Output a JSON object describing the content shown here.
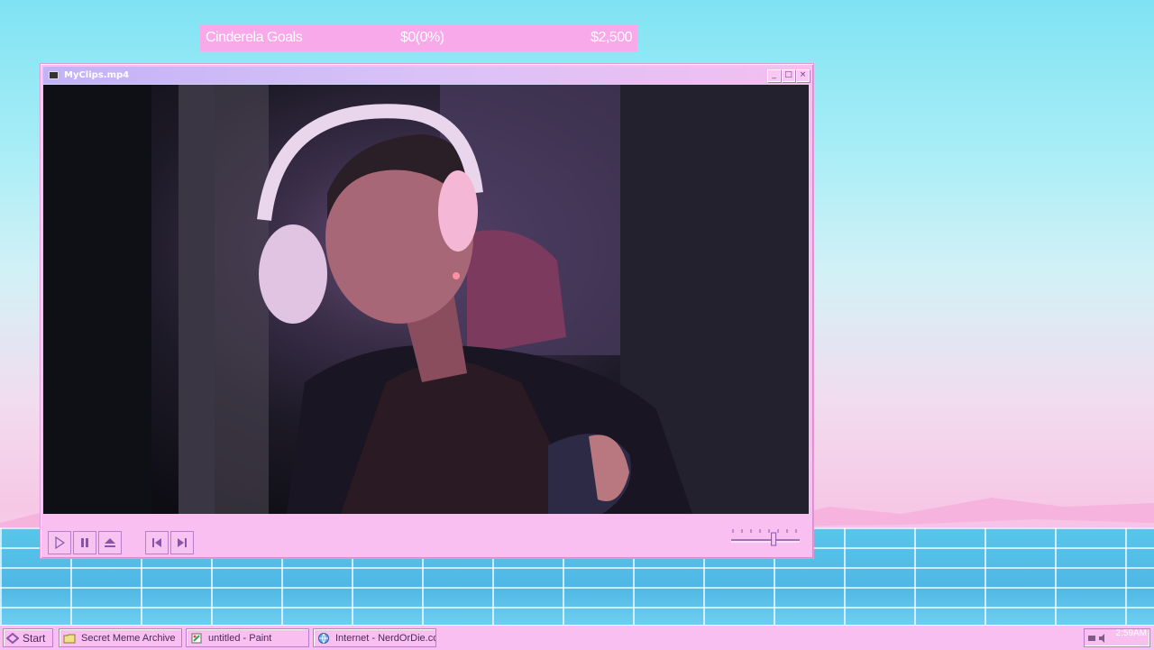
{
  "goal": {
    "name": "Cinderela Goals",
    "current": "$0(0%)",
    "target": "$2,500",
    "progress_fraction": 0.0
  },
  "window": {
    "title": "MyClips.mp4",
    "minimize": "_",
    "maximize": "□",
    "close": "×"
  },
  "player": {
    "volume_fraction": 0.62
  },
  "taskbar": {
    "start_label": "Start",
    "items": [
      {
        "label": "Secret Meme Archive",
        "icon": "folder-icon"
      },
      {
        "label": "untitled - Paint",
        "icon": "paint-icon"
      },
      {
        "label": "Internet - NerdOrDie.com",
        "icon": "internet-icon"
      }
    ],
    "clock": "2:59AM"
  },
  "colors": {
    "accent": "#f9bff0",
    "goal_bar": "#f8a9ea",
    "title_gradient_start": "#c2b2f7"
  }
}
